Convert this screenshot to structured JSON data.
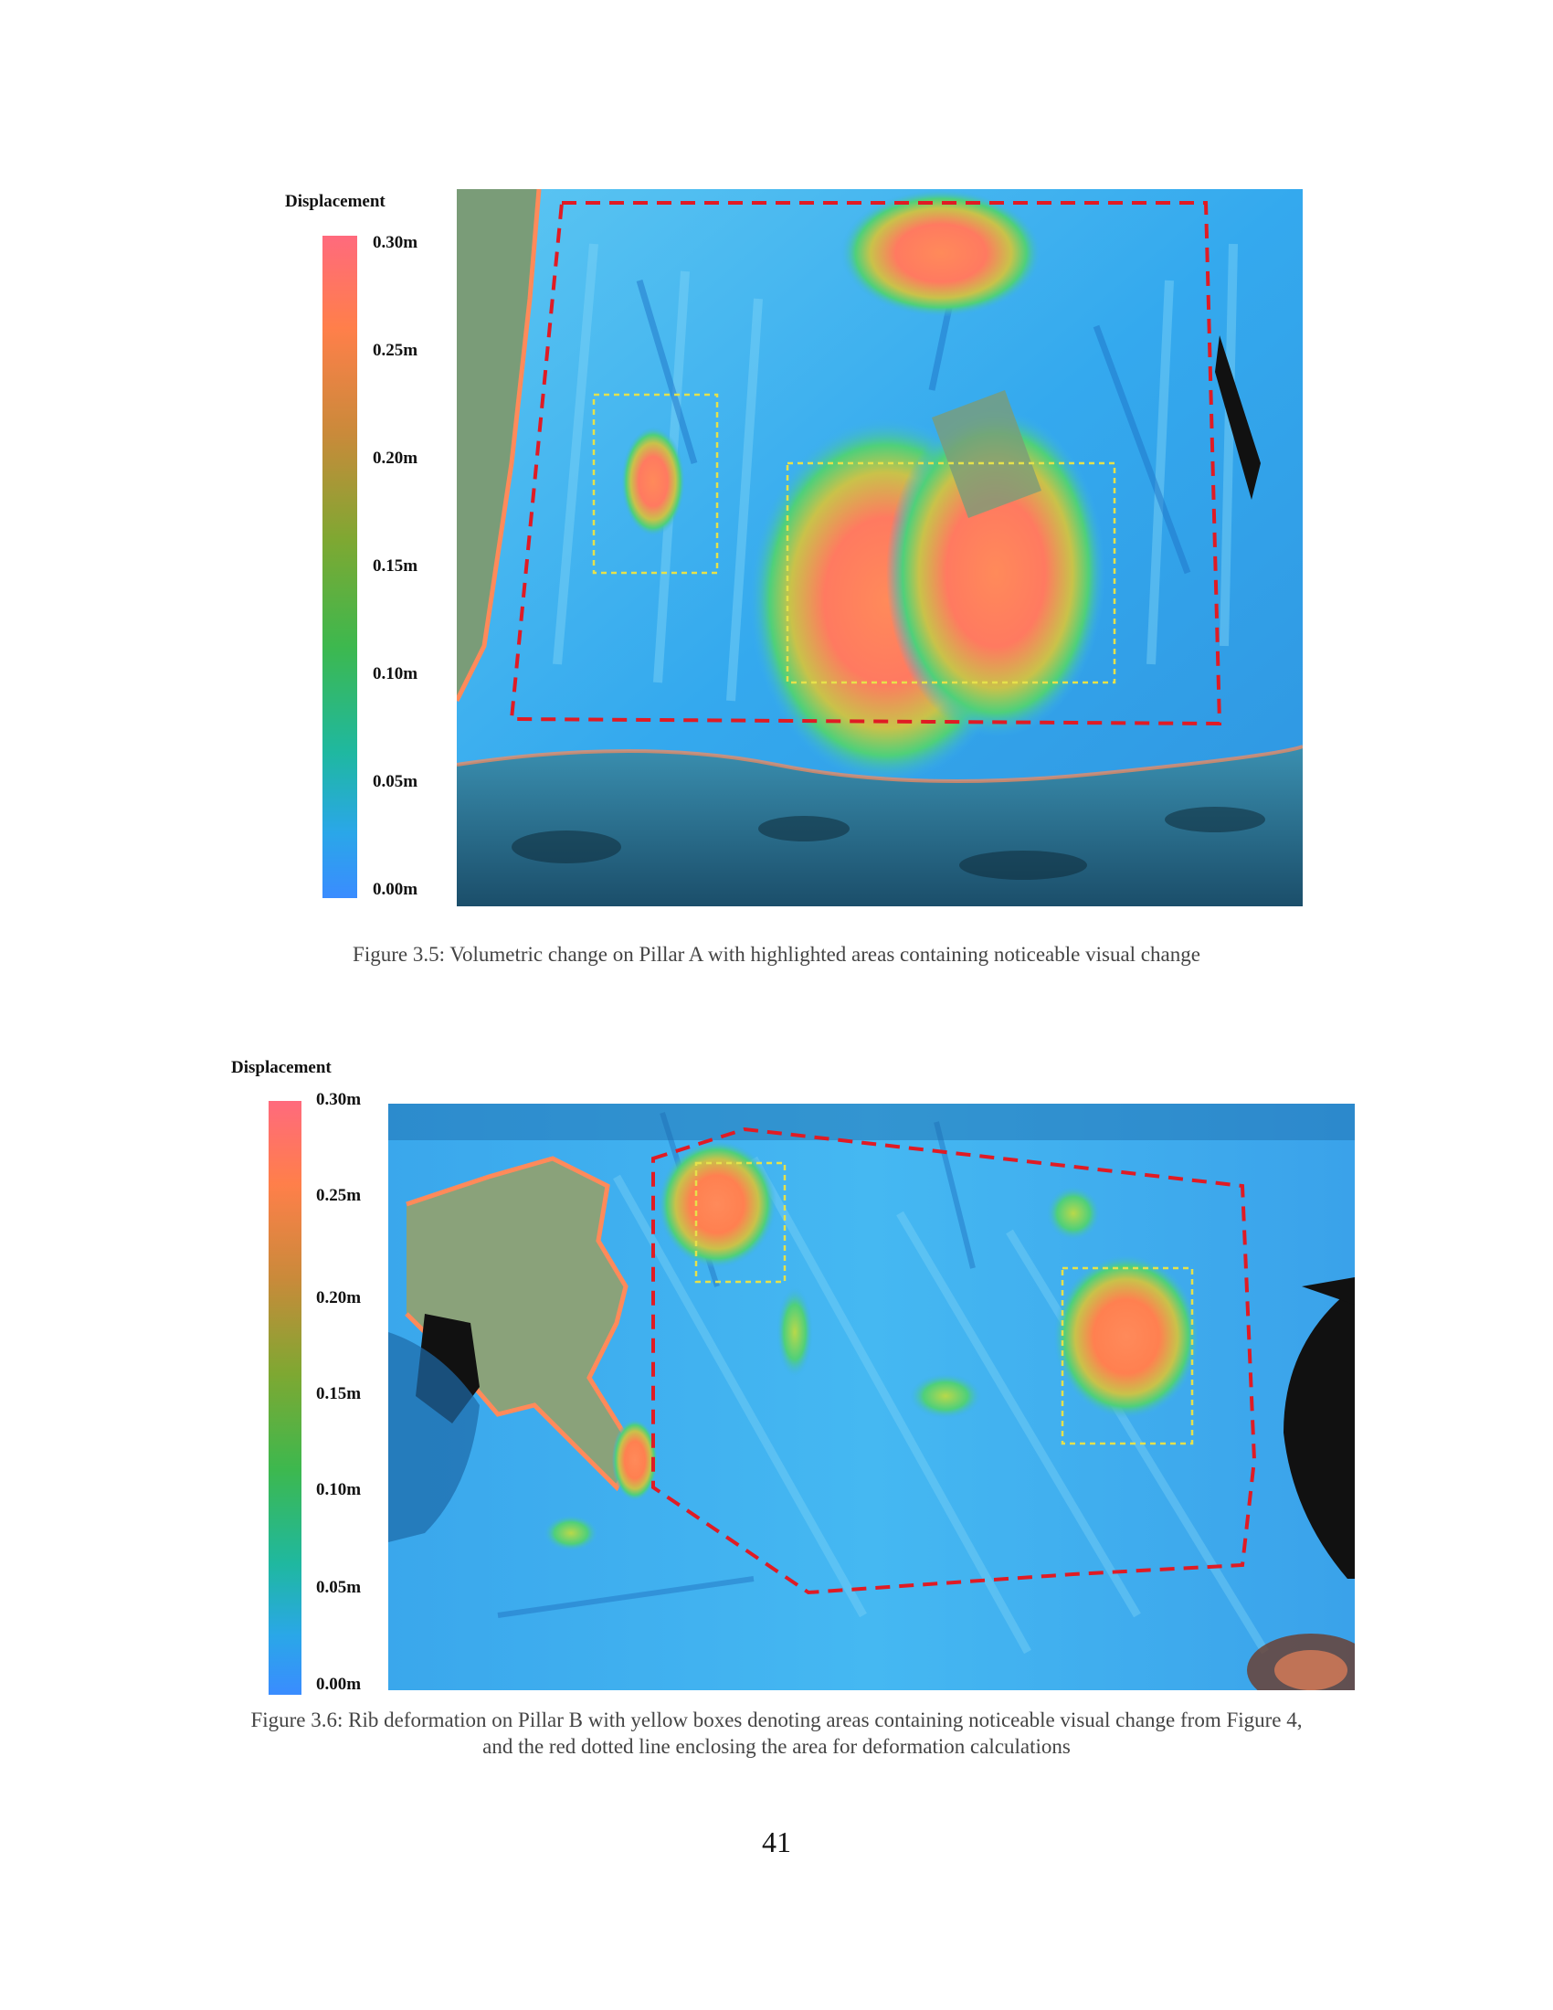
{
  "figures": [
    {
      "id": "fig-3-5",
      "legend_title": "Displacement",
      "ticks": [
        "0.30m",
        "0.25m",
        "0.20m",
        "0.15m",
        "0.10m",
        "0.05m",
        "0.00m"
      ],
      "caption": "Figure 3.5:  Volumetric change on Pillar A with highlighted areas containing noticeable visual change"
    },
    {
      "id": "fig-3-6",
      "legend_title": "Displacement",
      "ticks": [
        "0.30m",
        "0.25m",
        "0.20m",
        "0.15m",
        "0.10m",
        "0.05m",
        "0.00m"
      ],
      "caption_line1": "Figure 3.6:  Rib deformation on Pillar B with yellow boxes denoting areas containing noticeable visual change from Figure 4,",
      "caption_line2": "and the red dotted line enclosing the area for deformation calculations"
    }
  ],
  "colors": {
    "colormap": [
      "#ff6a7d",
      "#ff7f4a",
      "#c98a3a",
      "#7ea832",
      "#3db84e",
      "#1fb8a0",
      "#2aa7e8",
      "#3a8cff"
    ],
    "surface_blue": "#3cb0ef",
    "surface_light": "#7fd4f7",
    "rock_green": "#7a9c78",
    "hot": "#ff8a5a",
    "red_outline": "#e01b24",
    "yellow_box": "#e6e14a"
  },
  "page_number": "41"
}
